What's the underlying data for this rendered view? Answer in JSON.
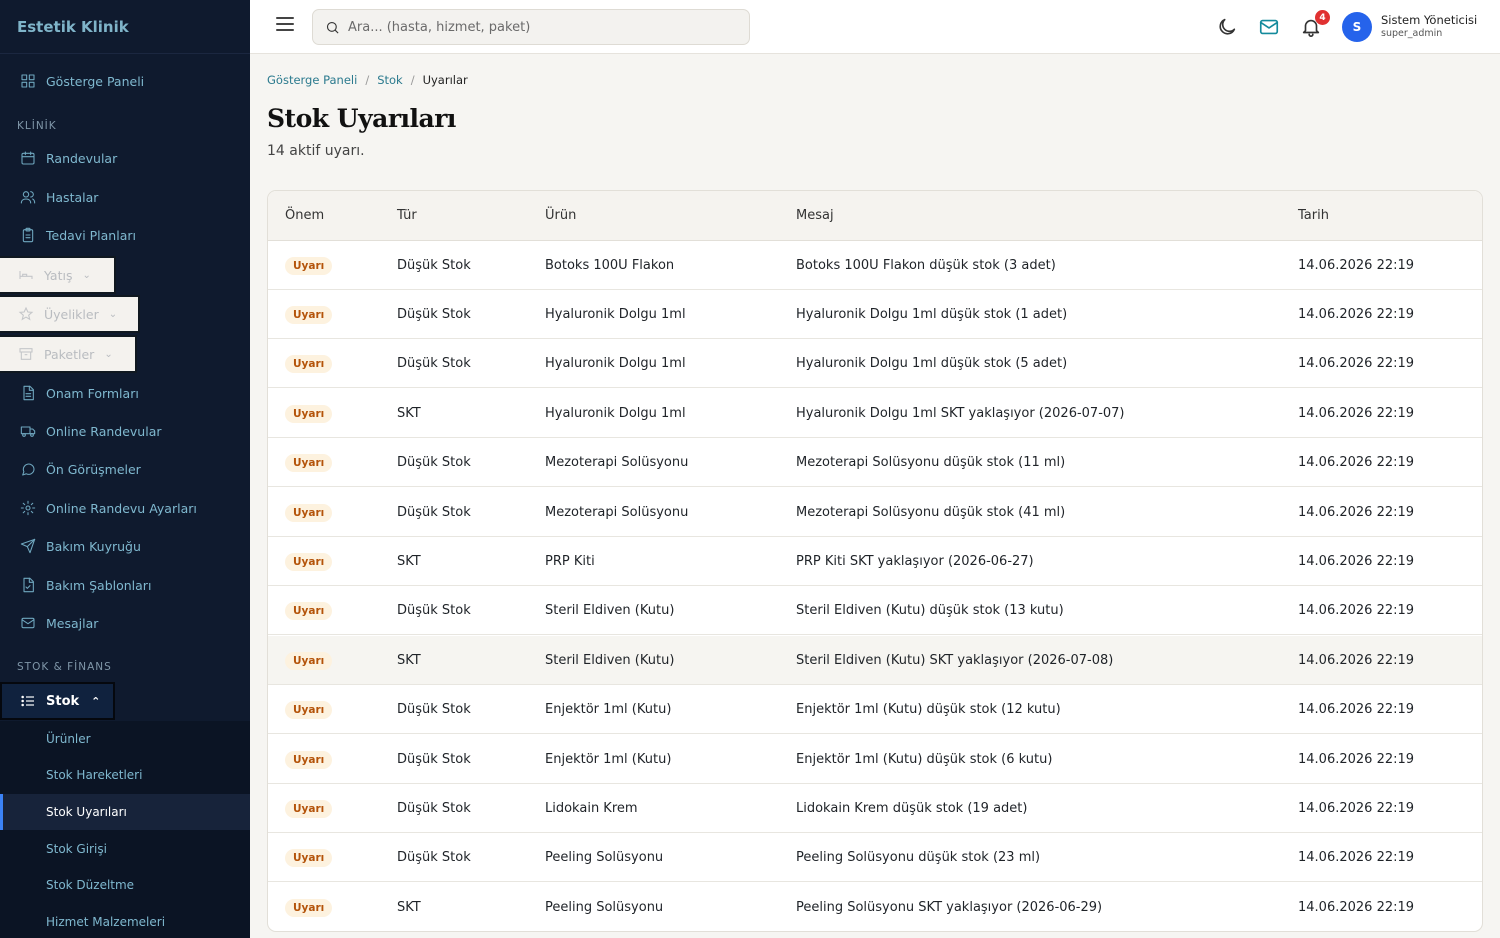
{
  "brand": "Estetik Klinik",
  "sidebar": {
    "dashboard": "Gösterge Paneli",
    "section_klinik": "KLİNİK",
    "randevular": "Randevular",
    "hastalar": "Hastalar",
    "tedavi": "Tedavi Planları",
    "yatis": "Yatış",
    "uyelikler": "Üyelikler",
    "paketler": "Paketler",
    "onam": "Onam Formları",
    "online_randevular": "Online Randevular",
    "on_gorusmeler": "Ön Görüşmeler",
    "online_ayarlar": "Online Randevu Ayarları",
    "bakim_kuyrugu": "Bakım Kuyruğu",
    "bakim_sablonlari": "Bakım Şablonları",
    "mesajlar": "Mesajlar",
    "section_stok": "STOK & FİNANS",
    "stok": "Stok",
    "sub": {
      "urunler": "Ürünler",
      "hareketler": "Stok Hareketleri",
      "uyarilar": "Stok Uyarıları",
      "girisi": "Stok Girişi",
      "duzeltme": "Stok Düzeltme",
      "hizmet": "Hizmet Malzemeleri"
    }
  },
  "topbar": {
    "search_placeholder": "Ara... (hasta, hizmet, paket)",
    "notification_count": "4",
    "avatar_initial": "S",
    "user_name": "Sistem Yöneticisi",
    "user_role": "super_admin"
  },
  "breadcrumb": {
    "home": "Gösterge Paneli",
    "stok": "Stok",
    "current": "Uyarılar"
  },
  "page": {
    "title": "Stok Uyarıları",
    "subtitle": "14 aktif uyarı."
  },
  "table": {
    "headers": {
      "onem": "Önem",
      "tur": "Tür",
      "urun": "Ürün",
      "mesaj": "Mesaj",
      "tarih": "Tarih"
    },
    "rows": [
      {
        "onem": "Uyarı",
        "tur": "Düşük Stok",
        "urun": "Botoks 100U Flakon",
        "mesaj": "Botoks 100U Flakon düşük stok (3 adet)",
        "tarih": "14.06.2026 22:19"
      },
      {
        "onem": "Uyarı",
        "tur": "Düşük Stok",
        "urun": "Hyaluronik Dolgu 1ml",
        "mesaj": "Hyaluronik Dolgu 1ml düşük stok (1 adet)",
        "tarih": "14.06.2026 22:19"
      },
      {
        "onem": "Uyarı",
        "tur": "Düşük Stok",
        "urun": "Hyaluronik Dolgu 1ml",
        "mesaj": "Hyaluronik Dolgu 1ml düşük stok (5 adet)",
        "tarih": "14.06.2026 22:19"
      },
      {
        "onem": "Uyarı",
        "tur": "SKT",
        "urun": "Hyaluronik Dolgu 1ml",
        "mesaj": "Hyaluronik Dolgu 1ml SKT yaklaşıyor (2026-07-07)",
        "tarih": "14.06.2026 22:19"
      },
      {
        "onem": "Uyarı",
        "tur": "Düşük Stok",
        "urun": "Mezoterapi Solüsyonu",
        "mesaj": "Mezoterapi Solüsyonu düşük stok (11 ml)",
        "tarih": "14.06.2026 22:19"
      },
      {
        "onem": "Uyarı",
        "tur": "Düşük Stok",
        "urun": "Mezoterapi Solüsyonu",
        "mesaj": "Mezoterapi Solüsyonu düşük stok (41 ml)",
        "tarih": "14.06.2026 22:19"
      },
      {
        "onem": "Uyarı",
        "tur": "SKT",
        "urun": "PRP Kiti",
        "mesaj": "PRP Kiti SKT yaklaşıyor (2026-06-27)",
        "tarih": "14.06.2026 22:19"
      },
      {
        "onem": "Uyarı",
        "tur": "Düşük Stok",
        "urun": "Steril Eldiven (Kutu)",
        "mesaj": "Steril Eldiven (Kutu) düşük stok (13 kutu)",
        "tarih": "14.06.2026 22:19"
      },
      {
        "onem": "Uyarı",
        "tur": "SKT",
        "urun": "Steril Eldiven (Kutu)",
        "mesaj": "Steril Eldiven (Kutu) SKT yaklaşıyor (2026-07-08)",
        "tarih": "14.06.2026 22:19"
      },
      {
        "onem": "Uyarı",
        "tur": "Düşük Stok",
        "urun": "Enjektör 1ml (Kutu)",
        "mesaj": "Enjektör 1ml (Kutu) düşük stok (12 kutu)",
        "tarih": "14.06.2026 22:19"
      },
      {
        "onem": "Uyarı",
        "tur": "Düşük Stok",
        "urun": "Enjektör 1ml (Kutu)",
        "mesaj": "Enjektör 1ml (Kutu) düşük stok (6 kutu)",
        "tarih": "14.06.2026 22:19"
      },
      {
        "onem": "Uyarı",
        "tur": "Düşük Stok",
        "urun": "Lidokain Krem",
        "mesaj": "Lidokain Krem düşük stok (19 adet)",
        "tarih": "14.06.2026 22:19"
      },
      {
        "onem": "Uyarı",
        "tur": "Düşük Stok",
        "urun": "Peeling Solüsyonu",
        "mesaj": "Peeling Solüsyonu düşük stok (23 ml)",
        "tarih": "14.06.2026 22:19"
      },
      {
        "onem": "Uyarı",
        "tur": "SKT",
        "urun": "Peeling Solüsyonu",
        "mesaj": "Peeling Solüsyonu SKT yaklaşıyor (2026-06-29)",
        "tarih": "14.06.2026 22:19"
      }
    ]
  },
  "colors": {
    "sidebar_bg": "#0f1a2e",
    "accent": "#2563eb",
    "badge": "#e03131",
    "warning_pill_bg": "#fdf2df",
    "warning_pill_text": "#b45309"
  }
}
